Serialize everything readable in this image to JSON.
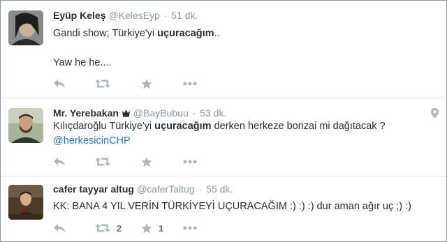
{
  "tweets": [
    {
      "name": "Eyüp Keleş",
      "username": "@KelesEyp",
      "separator": "·",
      "time": "51 dk.",
      "line1_pre": "Gandi show; Türkiye'yi ",
      "line1_bold": "uçuracağım",
      "line1_post": "..",
      "line2": "Yaw he  he....",
      "retweets": "",
      "favorites": ""
    },
    {
      "name": "Mr. Yerebakan",
      "username": "@BayBubuu",
      "separator": "·",
      "time": "53 dk.",
      "line1_pre": "Kılıçdaroğlu Türkiye'yi ",
      "line1_bold": "uçuracağım",
      "line1_post": " derken herkeze bonzai mi dağıtacak ?",
      "line2": "@herkesicinCHP",
      "retweets": "",
      "favorites": ""
    },
    {
      "name": "cafer tayyar altug",
      "username": "@caferTaltug",
      "separator": "·",
      "time": "55 dk.",
      "line1": "KK: BANA 4 YIL VERİN TÜRKİYEYİ UÇURACAĞIM :) :) :)  dur aman ağır uç ;) :)",
      "retweets": "2",
      "favorites": "1"
    }
  ],
  "icons": {
    "reply": "reply-icon",
    "retweet": "retweet-icon",
    "favorite": "star-icon",
    "more": "more-dots-icon",
    "badge": "crown-badge-icon",
    "geo": "location-pin-icon"
  },
  "colors": {
    "icon_gray": "#aab8c2",
    "muted_text": "#8899a6",
    "link": "#2b7bb9",
    "divider": "#e1e8ed"
  }
}
